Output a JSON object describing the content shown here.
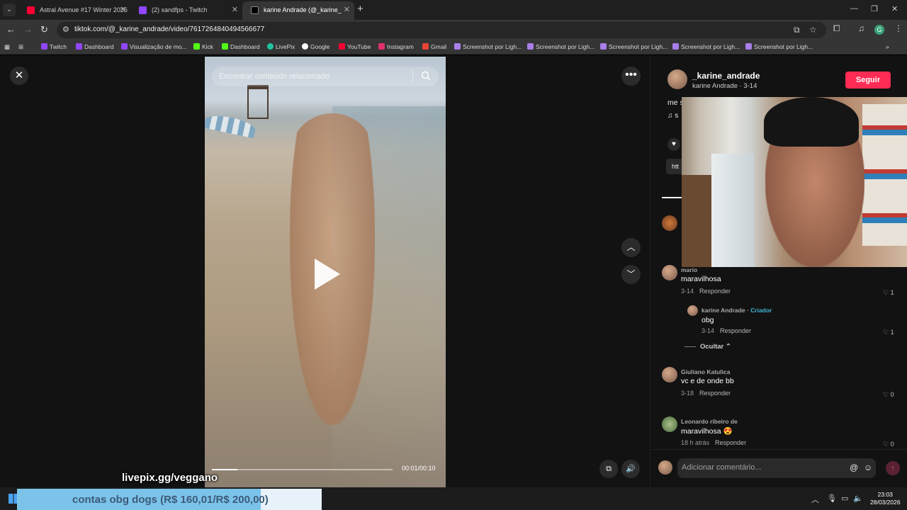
{
  "browser": {
    "tabs": [
      {
        "label": "Astral Avenue #17 Winter 2026",
        "close": "✕",
        "icon_color": "#ff0033"
      },
      {
        "label": "(2) xandfps - Twitch",
        "close": "✕",
        "icon_color": "#9146ff"
      },
      {
        "label": "karine Andrade (@_karine_",
        "close": "✕",
        "icon_color": "#111111",
        "active": true
      }
    ],
    "url": "tiktok.com/@_karine_andrade/video/7617264840494566677",
    "profile_initial": "G",
    "bookmarks": [
      {
        "label": "Twitch",
        "icon_color": "#9146ff"
      },
      {
        "label": "Dashboard",
        "icon_color": "#9146ff"
      },
      {
        "label": "Visualização de mo...",
        "icon_color": "#9146ff"
      },
      {
        "label": "Kick",
        "icon_color": "#53fc18"
      },
      {
        "label": "Dashboard",
        "icon_color": "#53fc18"
      },
      {
        "label": "LivePix",
        "icon_color": "#20c5a0"
      },
      {
        "label": "Google",
        "icon_color": "#ffffff"
      },
      {
        "label": "YouTube",
        "icon_color": "#ff0033"
      },
      {
        "label": "Instagram",
        "icon_color": "#e1306c"
      },
      {
        "label": "Gmail",
        "icon_color": "#ea4335"
      },
      {
        "label": "Screenshot por Ligh...",
        "icon_color": "#a97ee8"
      },
      {
        "label": "Screenshot por Ligh...",
        "icon_color": "#a97ee8"
      },
      {
        "label": "Screenshot por Ligh...",
        "icon_color": "#a97ee8"
      },
      {
        "label": "Screenshot por Ligh...",
        "icon_color": "#a97ee8"
      },
      {
        "label": "Screenshot por Ligh...",
        "icon_color": "#a97ee8"
      }
    ]
  },
  "video": {
    "search_placeholder": "Encontrar conteúdo relacionado",
    "time": "00:01/00:10",
    "progress_fraction": 0.14
  },
  "post": {
    "author": "_karine_andrade",
    "author_sub": "karine Andrade · 3-14",
    "follow_label": "Seguir",
    "desc": "me s",
    "music": "♫ s",
    "link": "htt"
  },
  "comments": [
    {
      "name": "mario",
      "text": "maravilhosa",
      "meta": "3-14",
      "reply": "Responder",
      "likes": "1"
    },
    {
      "name": "karine Andrade",
      "badge": "Criador",
      "text": "obg",
      "meta": "3-14",
      "reply": "Responder",
      "likes": "1"
    },
    {
      "name": "Giuliano Katulica",
      "text": "vc e de onde bb",
      "meta": "3-18",
      "reply": "Responder",
      "likes": "0"
    },
    {
      "name": "Leonardo ribeiro de",
      "text": "maravilhosa 😍",
      "meta": "18 h atrás",
      "reply": "Responder",
      "likes": "0"
    }
  ],
  "hide_label": "Ocultar",
  "composer_placeholder": "Adicionar comentário...",
  "overlay": {
    "livepix": "livepix.gg/veggano",
    "goal_text": "contas obg dogs (R$ 160,01/R$ 200,00)",
    "goal_fraction": 0.8
  },
  "clock": {
    "time": "23:03",
    "date": "28/03/2026"
  },
  "colors": {
    "accent": "#fe2c55",
    "creator": "#42b4d6"
  }
}
